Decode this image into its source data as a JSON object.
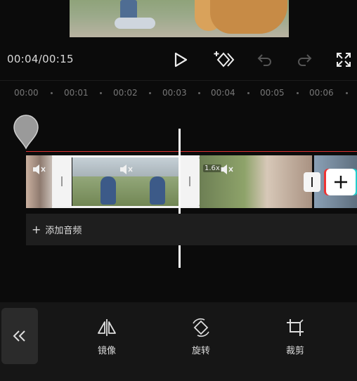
{
  "player": {
    "time_readout": "00:04/00:15"
  },
  "timeline": {
    "ruler_ticks": [
      "00:00",
      "00:01",
      "00:02",
      "00:03",
      "00:04",
      "00:05",
      "00:06"
    ],
    "speed_badge": "1.6x"
  },
  "audio": {
    "add_audio_label": "添加音频"
  },
  "toolbar": {
    "mirror_label": "镜像",
    "rotate_label": "旋转",
    "crop_label": "裁剪"
  },
  "icons": {
    "play": "play-icon",
    "keyframe": "keyframe-icon",
    "undo": "undo-icon",
    "redo": "redo-icon",
    "fullscreen": "fullscreen-icon",
    "back": "double-chevron-left-icon",
    "mirror": "mirror-icon",
    "rotate": "rotate-icon",
    "crop": "crop-icon"
  },
  "colors": {
    "background": "#0b0b0b",
    "playhead": "#fafafa",
    "marker_line": "#dd3333",
    "selection": "#f3f3f3"
  }
}
